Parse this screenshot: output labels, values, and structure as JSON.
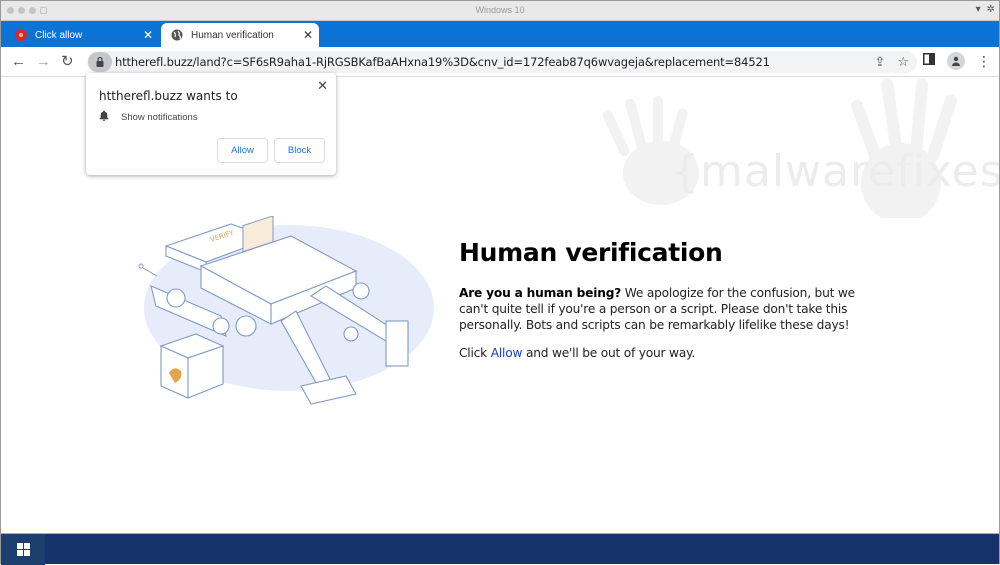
{
  "window": {
    "title": "Windows 10"
  },
  "tabs": [
    {
      "label": "Click allow",
      "icon": "red-favicon-icon",
      "active": false
    },
    {
      "label": "Human verification",
      "icon": "globe-icon",
      "active": true
    }
  ],
  "tab_close_glyph": "✕",
  "new_tab_glyph": "+",
  "address_bar": {
    "url": "httherefl.buzz/land?c=SF6sR9aha1-RjRGSBKafBaAHxna19%3D&cnv_id=172feab87q6wvageja&replacement=84521"
  },
  "permission_popup": {
    "title": "httherefl.buzz wants to",
    "permission": "Show notifications",
    "allow_label": "Allow",
    "block_label": "Block",
    "close_glyph": "✕"
  },
  "page": {
    "heading": "Human verification",
    "para1_bold": "Are you a human being?",
    "para1_rest": " We apologize for the confusion, but we can't quite tell if you're a person or a script. Please don't take this personally. Bots and scripts can be remarkably lifelike these days!",
    "para2_prefix": "Click ",
    "para2_link": "Allow",
    "para2_suffix": " and we'll be out of your way."
  },
  "watermark": {
    "text": "{malwarefixes}"
  },
  "colors": {
    "tabstrip": "#0b72d6",
    "taskbar": "#16326b",
    "link": "#1a3dc4",
    "popup_button_text": "#1a73e8"
  }
}
